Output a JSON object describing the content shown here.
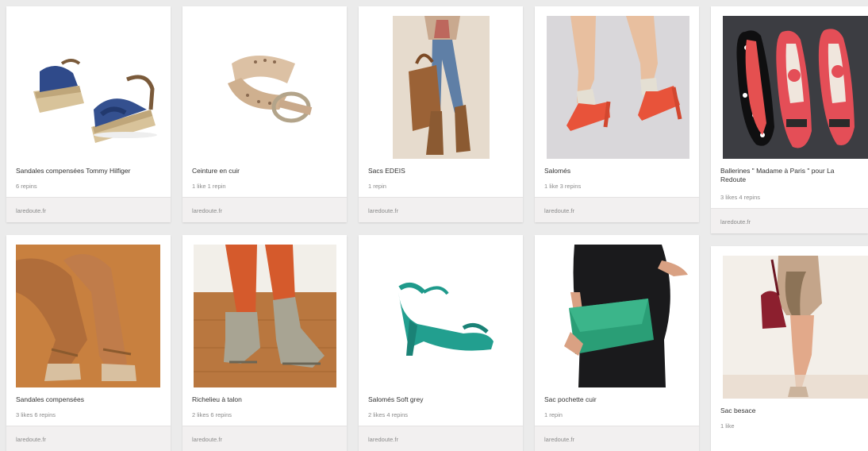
{
  "pins": [
    {
      "title": "Sandales compensées Tommy Hilfiger",
      "stats": "6 repins",
      "source": "laredoute.fr",
      "image": "blue-wedge-sandals"
    },
    {
      "title": "Ceinture en cuir",
      "stats": "1 like  1 repin",
      "source": "laredoute.fr",
      "image": "leather-belt"
    },
    {
      "title": "Sacs EDEIS",
      "stats": "1 repin",
      "source": "laredoute.fr",
      "image": "brown-backpack"
    },
    {
      "title": "Salomés",
      "stats": "1 like  3 repins",
      "source": "laredoute.fr",
      "image": "coral-heels"
    },
    {
      "title": "Ballerines \" Madame à Paris \" pour La Redoute",
      "stats": "3 likes  4 repins",
      "source": "laredoute.fr",
      "image": "polka-dot-ballerinas"
    },
    {
      "title": "Sandales compensées",
      "stats": "3 likes  6 repins",
      "source": "laredoute.fr",
      "image": "tan-wedge-sandals"
    },
    {
      "title": "Richelieu à talon",
      "stats": "2 likes  6 repins",
      "source": "laredoute.fr",
      "image": "grey-oxford-heels"
    },
    {
      "title": "Salomés Soft grey",
      "stats": "2 likes  4 repins",
      "source": "laredoute.fr",
      "image": "teal-heel"
    },
    {
      "title": "Sac pochette cuir",
      "stats": "1 repin",
      "source": "laredoute.fr",
      "image": "green-clutch"
    },
    {
      "title": "Sac besace",
      "stats": "1 like",
      "source": "",
      "image": "red-crossbody-bag"
    }
  ]
}
